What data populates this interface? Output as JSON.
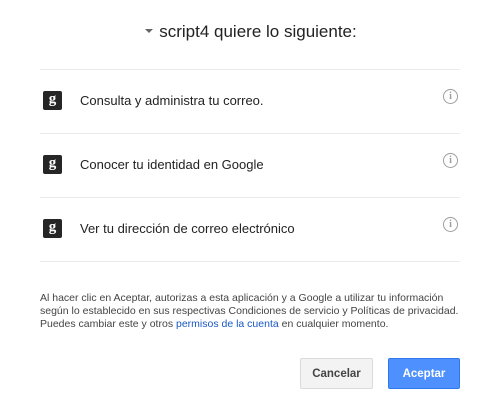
{
  "header": {
    "title": "script4 quiere lo siguiente:"
  },
  "scopes": [
    {
      "label": "Consulta y administra tu correo.",
      "icon": "google-g-icon"
    },
    {
      "label": "Conocer tu identidad en Google",
      "icon": "google-g-icon"
    },
    {
      "label": "Ver tu dirección de correo electrónico",
      "icon": "google-g-icon"
    }
  ],
  "consent": {
    "text_before": "Al hacer clic en Aceptar, autorizas a esta aplicación y a Google a utilizar tu información según lo establecido en sus respectivas Condiciones de servicio y Políticas de privacidad. Puedes cambiar este y otros ",
    "link_text": "permisos de la cuenta",
    "text_after": " en cualquier momento."
  },
  "buttons": {
    "cancel_label": "Cancelar",
    "accept_label": "Aceptar"
  },
  "colors": {
    "accent": "#4d90fe",
    "link": "#1a57c5"
  }
}
